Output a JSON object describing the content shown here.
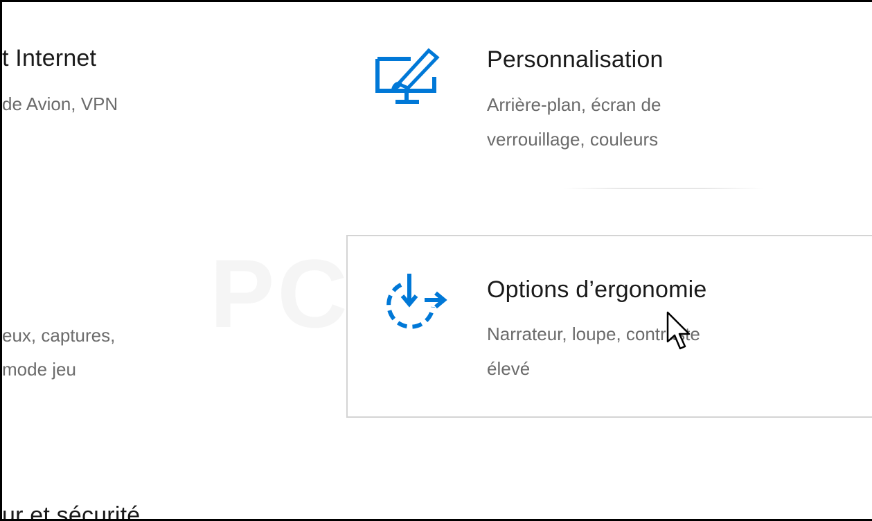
{
  "left_column": {
    "network": {
      "title": "t Internet",
      "desc_line1": "de Avion, VPN"
    },
    "gaming": {
      "desc_line1": "eux, captures,",
      "desc_line2": "mode jeu"
    },
    "update": {
      "title": "ur et sécurité"
    }
  },
  "right_column": {
    "personalization": {
      "icon": "personalization-monitor-brush-icon",
      "title": "Personnalisation",
      "desc_line1": "Arrière-plan, écran de",
      "desc_line2": "verrouillage, couleurs"
    },
    "ease_of_access": {
      "icon": "ease-of-access-clock-arrow-icon",
      "title": "Options d’ergonomie",
      "desc_line1": "Narrateur, loupe, contraste",
      "desc_line2": "élevé"
    }
  },
  "colors": {
    "accent": "#0078d7",
    "title_text": "#1a1a1a",
    "desc_text": "#6b6b6b"
  }
}
